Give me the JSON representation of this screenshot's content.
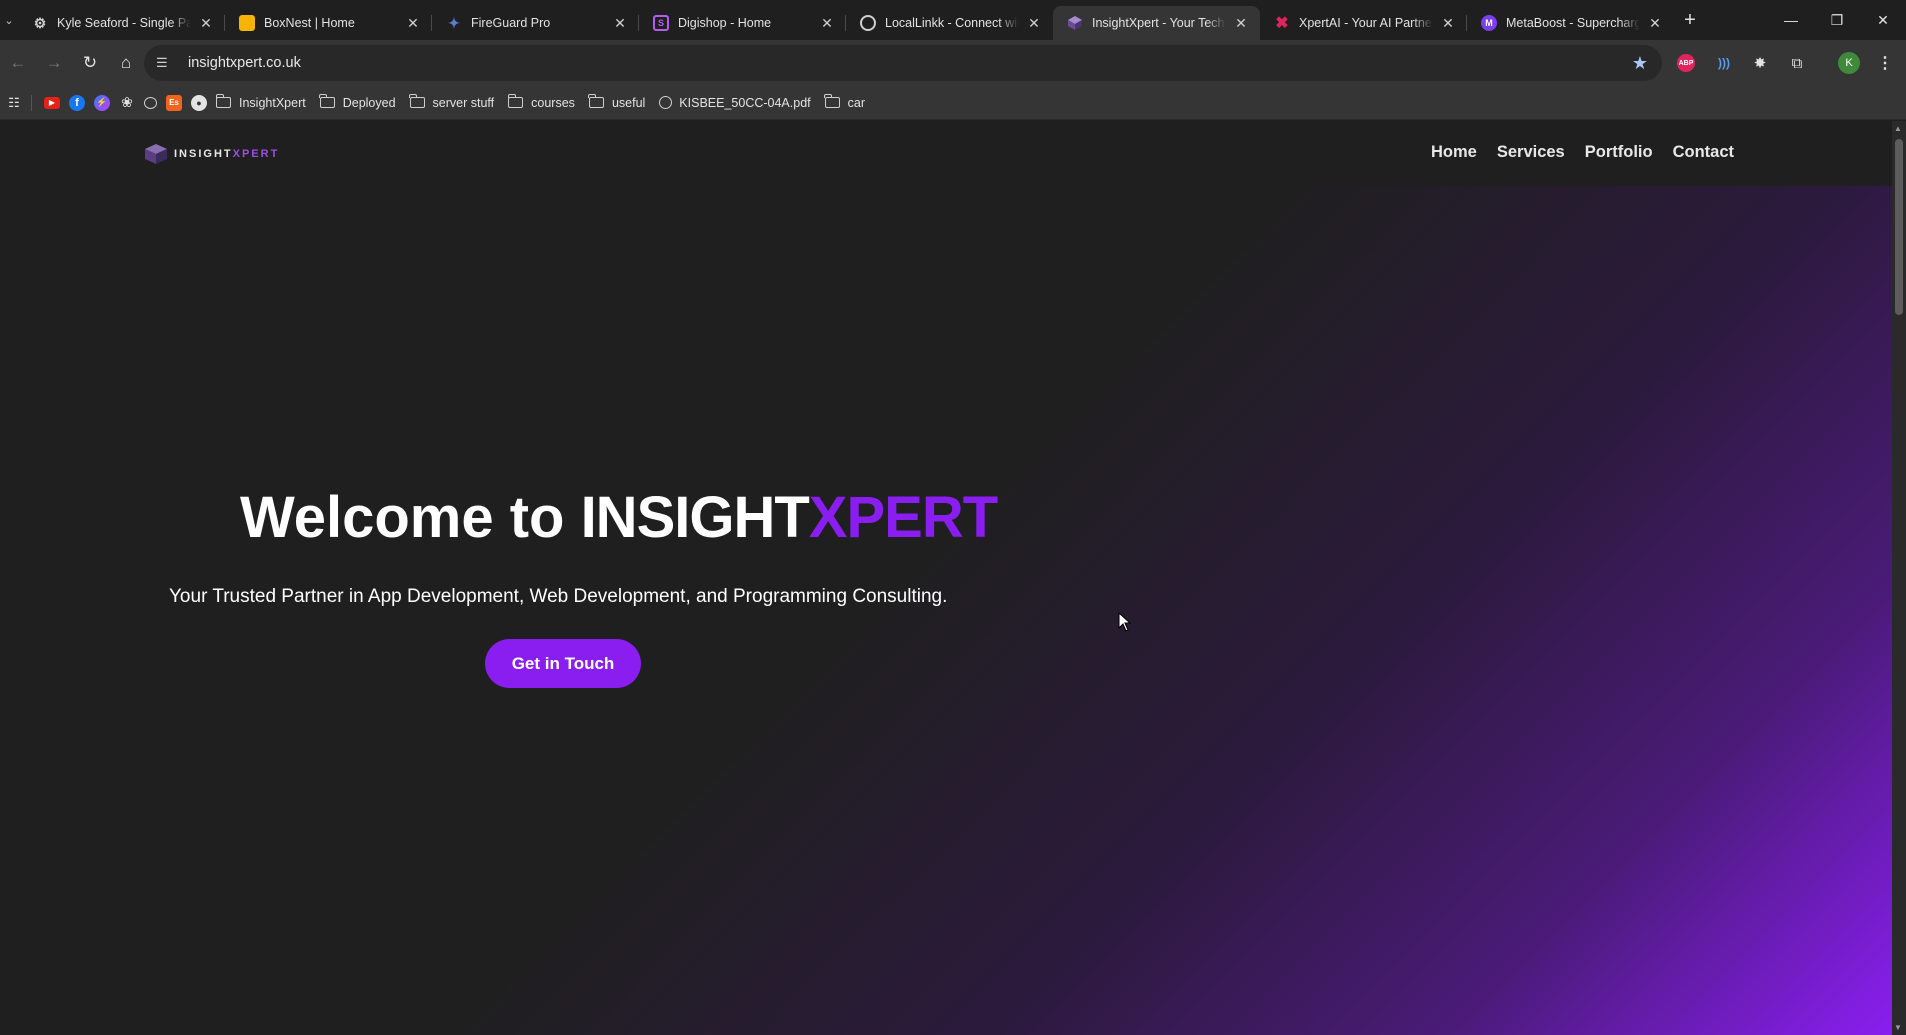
{
  "browser": {
    "tabs": [
      {
        "title": "Kyle Seaford - Single Page",
        "icon": "gear-icon",
        "color": "#cfcfcf",
        "active": false
      },
      {
        "title": "BoxNest | Home",
        "icon": "box-icon",
        "color": "#f4b400",
        "active": false
      },
      {
        "title": "FireGuard Pro",
        "icon": "shield-icon",
        "color": "#5b7bd5",
        "active": false
      },
      {
        "title": "Digishop - Home",
        "icon": "digishop-icon",
        "color": "#b35cf0",
        "active": false
      },
      {
        "title": "LocalLinkk - Connect with",
        "icon": "link-icon",
        "color": "#cfcfcf",
        "active": false
      },
      {
        "title": "InsightXpert - Your Tech P",
        "icon": "cube-icon",
        "color": "#8a6fb0",
        "active": true
      },
      {
        "title": "XpertAI - Your AI Partner",
        "icon": "x-logo-icon",
        "color": "#e0245e",
        "active": false
      },
      {
        "title": "MetaBoost - Supercharge",
        "icon": "metaboost-icon",
        "color": "#7a3ff0",
        "active": false
      }
    ],
    "url": "insightxpert.co.uk",
    "profile_initial": "K",
    "bookmarks": [
      {
        "label": "InsightXpert",
        "type": "folder"
      },
      {
        "label": "Deployed",
        "type": "folder"
      },
      {
        "label": "server stuff",
        "type": "folder"
      },
      {
        "label": "courses",
        "type": "folder"
      },
      {
        "label": "useful",
        "type": "folder"
      },
      {
        "label": "KISBEE_50CC-04A.pdf",
        "type": "globe"
      },
      {
        "label": "car",
        "type": "folder"
      }
    ]
  },
  "site": {
    "logo_text_main": "INSIGHT",
    "logo_text_accent": "XPERT",
    "nav": [
      "Home",
      "Services",
      "Portfolio",
      "Contact"
    ],
    "hero": {
      "title_prefix": "Welcome to ",
      "title_brand": "INSIGHT",
      "title_accent": "XPERT",
      "subtitle": "Your Trusted Partner in App Development, Web Development, and Programming Consulting.",
      "cta_label": "Get in Touch"
    },
    "colors": {
      "accent": "#8a1ef0",
      "background": "#1f1f1f"
    }
  }
}
